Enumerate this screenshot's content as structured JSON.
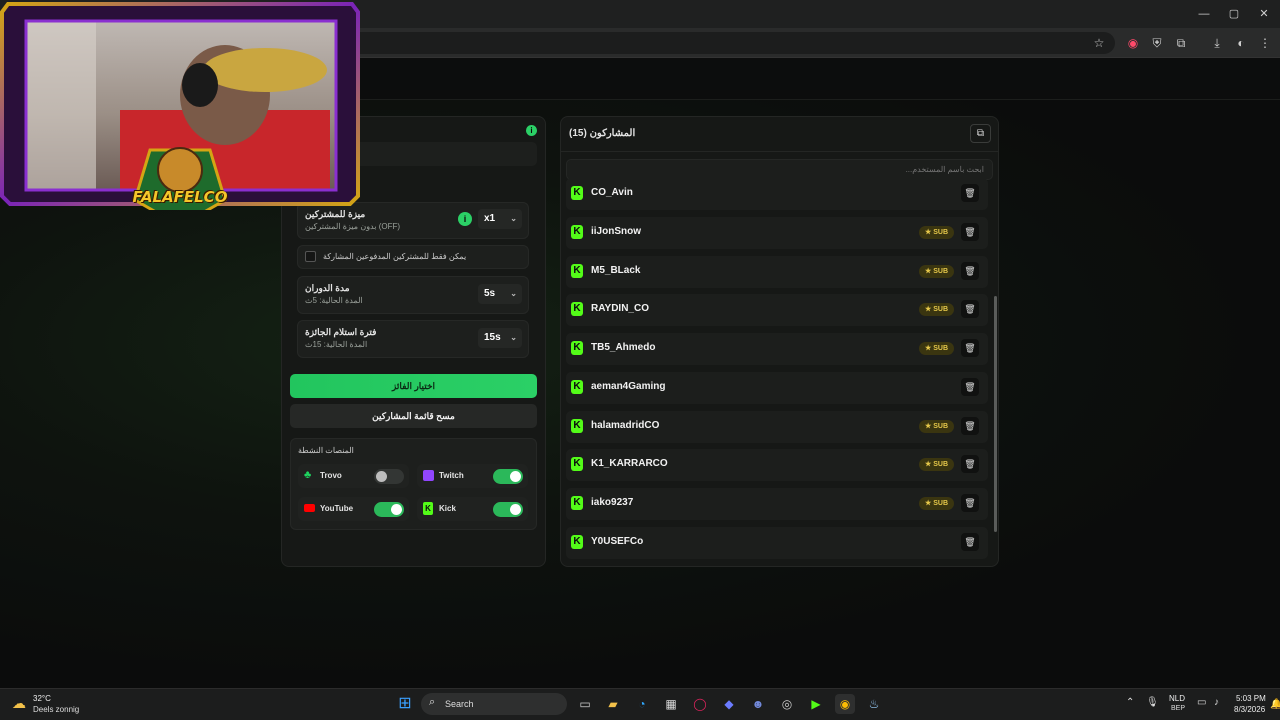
{
  "window": {
    "minimize": "—",
    "maximize": "▢",
    "close": "✕"
  },
  "toolbar_icons": [
    "star-icon",
    "extension-record-icon",
    "shield-icon",
    "puzzle-icon",
    "download-icon",
    "profile-icon",
    "kebab-menu-icon"
  ],
  "settings": {
    "feature_title": "ميزة للمشتركين",
    "feature_sub": "بدون ميزة المشتركين (OFF)",
    "multiplier": "x1",
    "subs_only_label": "يمكن فقط للمشتركين المدفوعين المشاركة",
    "spin_title": "مدة الدوران",
    "spin_sub": "المدة الحالية: 5ث",
    "spin_value": "5s",
    "claim_title": "فترة استلام الجائزة",
    "claim_sub": "المدة الحالية: 15ث",
    "claim_value": "15s",
    "pick_winner": "اختيار الفائز",
    "clear_list": "مسح قائمة المشاركين",
    "platforms_title": "المنصات النشطة",
    "platforms": [
      {
        "name": "Trovo",
        "on": false,
        "color": "#1ed760"
      },
      {
        "name": "Twitch",
        "on": true,
        "color": "#9146ff"
      },
      {
        "name": "YouTube",
        "on": true,
        "color": "#ff0000"
      },
      {
        "name": "Kick",
        "on": true,
        "color": "#53fc18"
      }
    ]
  },
  "participants": {
    "title": "المشاركون (15)",
    "search_placeholder": "ابحث باسم المستخدم...",
    "sub_badge": "★ SUB",
    "rows": [
      {
        "name": "CO_Avin",
        "sub": false
      },
      {
        "name": "iiJonSnow",
        "sub": true
      },
      {
        "name": "M5_BLack",
        "sub": true
      },
      {
        "name": "RAYDIN_CO",
        "sub": true
      },
      {
        "name": "TB5_Ahmedo",
        "sub": true
      },
      {
        "name": "aeman4Gaming",
        "sub": false
      },
      {
        "name": "halamadridCO",
        "sub": true
      },
      {
        "name": "K1_KARRARCO",
        "sub": true
      },
      {
        "name": "iako9237",
        "sub": true
      },
      {
        "name": "Y0USEFCo",
        "sub": false
      }
    ]
  },
  "webcam": {
    "logo_text": "FALAFELCO"
  },
  "taskbar": {
    "weather_temp": "32°C",
    "weather_desc": "Deels zonnig",
    "search": "Search",
    "lang": "NLD",
    "lang_sub": "BEP",
    "time": "5:03 PM",
    "date": "8/3/2026"
  },
  "colors": {
    "accent": "#2bd066",
    "kick": "#53fc18",
    "sub": "#e6c84a"
  }
}
